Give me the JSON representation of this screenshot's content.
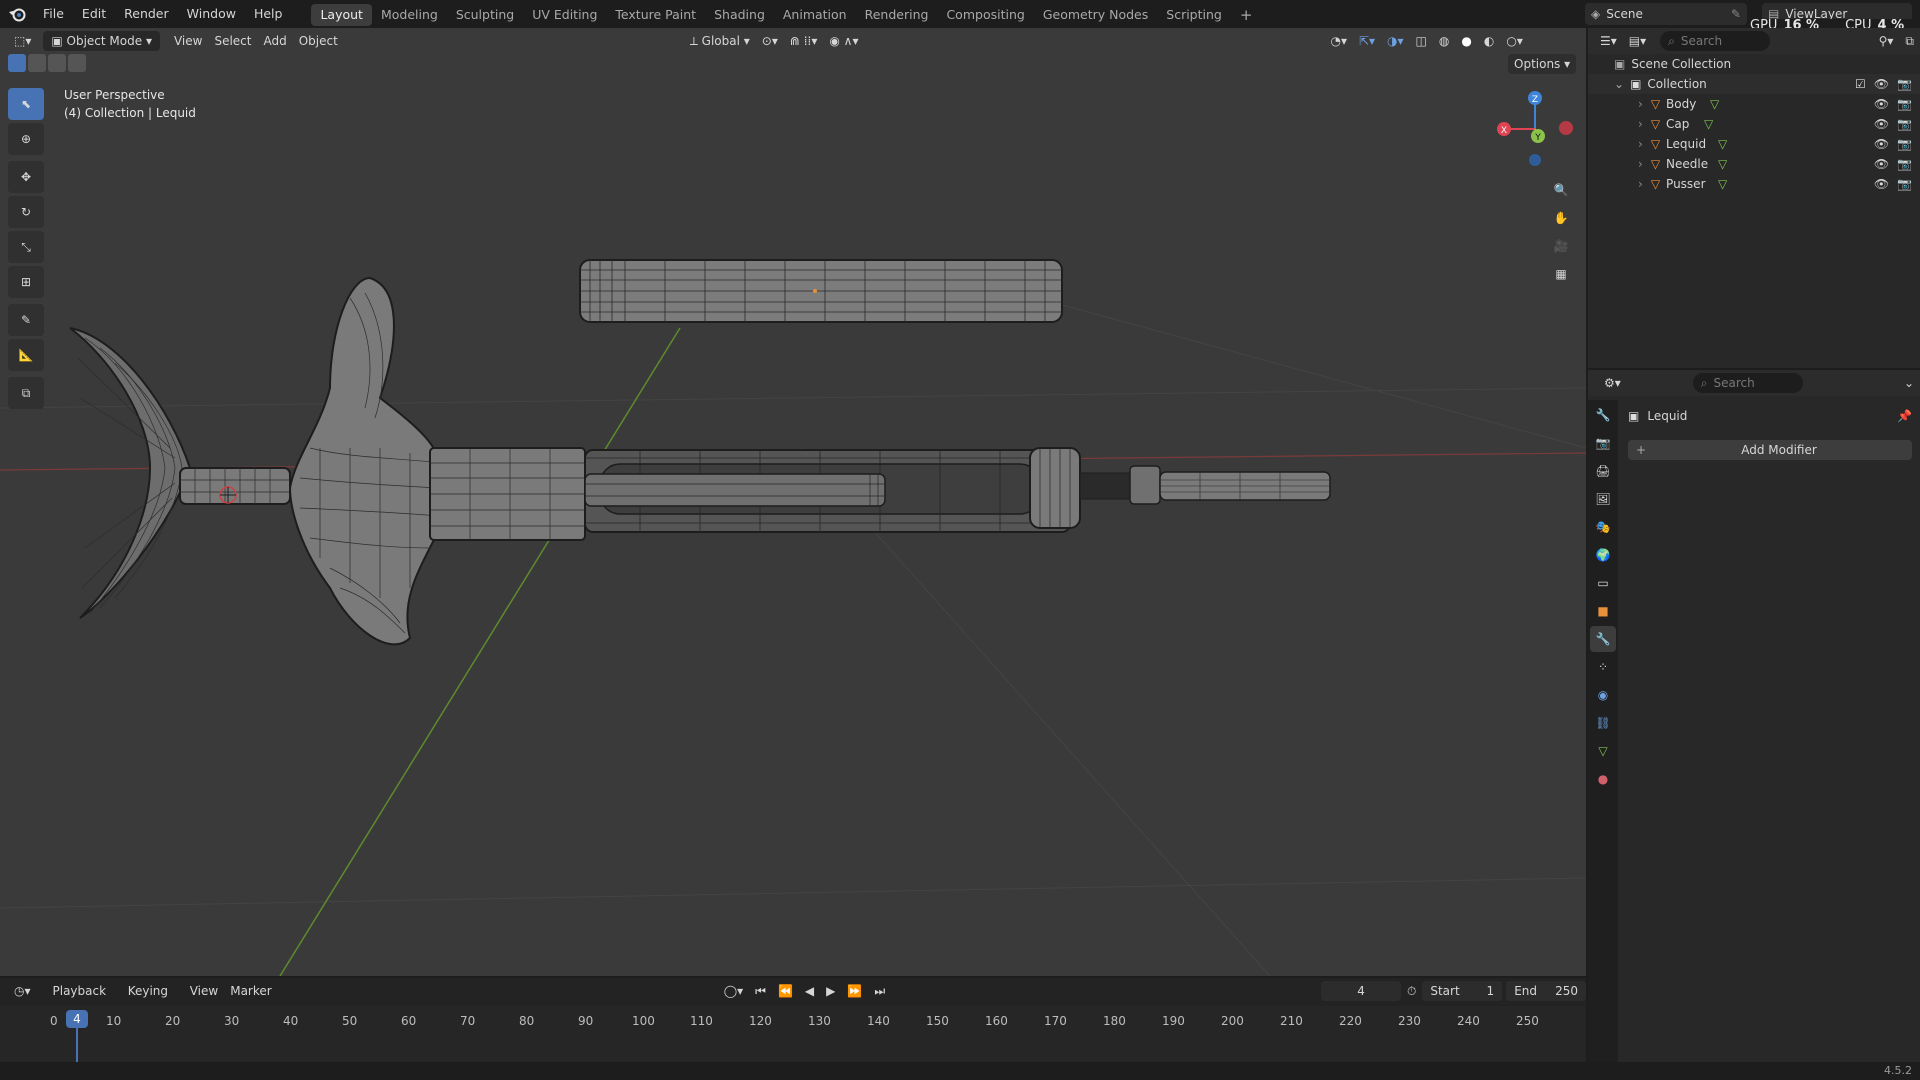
{
  "topbar": {
    "menus": [
      "File",
      "Edit",
      "Render",
      "Window",
      "Help"
    ],
    "workspaces": [
      "Layout",
      "Modeling",
      "Sculpting",
      "UV Editing",
      "Texture Paint",
      "Shading",
      "Animation",
      "Rendering",
      "Compositing",
      "Geometry Nodes",
      "Scripting"
    ],
    "active_workspace": "Layout",
    "add_tab": "+",
    "scene": "Scene",
    "view_layer": "ViewLayer",
    "gpu_label": "GPU",
    "gpu_value": "16 %",
    "cpu_label": "CPU",
    "cpu_value": "4 %"
  },
  "viewport": {
    "mode": "Object Mode",
    "menus": [
      "View",
      "Select",
      "Add",
      "Object"
    ],
    "orientation": "Global",
    "options": "Options",
    "overlay_line1": "User Perspective",
    "overlay_line2": "(4) Collection | Lequid",
    "gizmo": {
      "x": "X",
      "y": "Y",
      "z": "Z"
    }
  },
  "outliner": {
    "search_placeholder": "Search",
    "root": "Scene Collection",
    "collection": "Collection",
    "objects": [
      "Body",
      "Cap",
      "Lequid",
      "Needle",
      "Pusser"
    ]
  },
  "properties": {
    "search_placeholder": "Search",
    "object_name": "Lequid",
    "add_modifier": "Add Modifier"
  },
  "timeline": {
    "menus": [
      "Playback",
      "Keying",
      "View",
      "Marker"
    ],
    "current_frame": "4",
    "start_label": "Start",
    "start": "1",
    "end_label": "End",
    "end": "250",
    "ticks": [
      "0",
      "10",
      "20",
      "30",
      "40",
      "50",
      "60",
      "70",
      "80",
      "90",
      "100",
      "110",
      "120",
      "130",
      "140",
      "150",
      "160",
      "170",
      "180",
      "190",
      "200",
      "210",
      "220",
      "230",
      "240",
      "250"
    ],
    "frame_marker": "4"
  },
  "status": {
    "version": "4.5.2"
  },
  "colors": {
    "accent": "#4772b3",
    "orange": "#e8913a",
    "x_axis": "#e04452",
    "y_axis": "#8bc34a",
    "z_axis": "#3f84d9"
  }
}
